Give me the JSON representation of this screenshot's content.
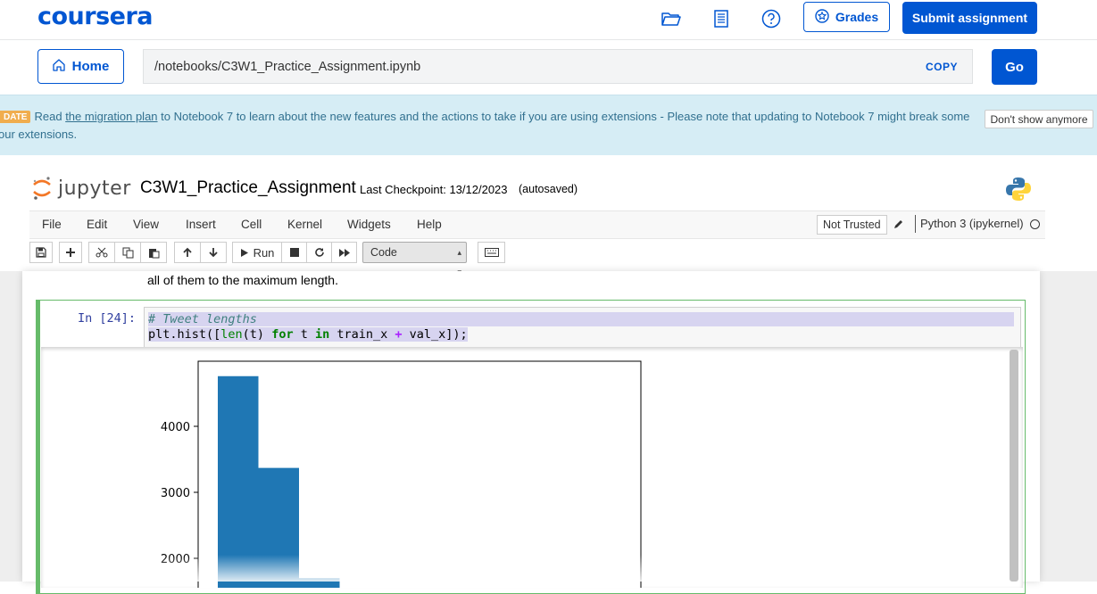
{
  "coursera": {
    "logo": "coursera",
    "icons": [
      "folder-icon",
      "notes-icon",
      "help-icon"
    ],
    "grades_label": "Grades",
    "submit_label": "Submit assignment",
    "home_label": "Home",
    "path": "/notebooks/C3W1_Practice_Assignment.ipynb",
    "copy_label": "COPY",
    "go_label": "Go",
    "brand_color": "#0056d2"
  },
  "banner": {
    "badge": "DATE",
    "text_before": "Read ",
    "link_text": "the migration plan",
    "text_after": " to Notebook 7 to learn about the new features and the actions to take if you are using extensions - Please note that updating to Notebook 7 might break some our extensions.",
    "dismiss_label": "Don't show anymore"
  },
  "jupyter": {
    "logo_text": "jupyter",
    "notebook_title": "C3W1_Practice_Assignment",
    "checkpoint": "Last Checkpoint: 13/12/2023",
    "autosave": "(autosaved)",
    "menu": [
      "File",
      "Edit",
      "View",
      "Insert",
      "Cell",
      "Kernel",
      "Widgets",
      "Help"
    ],
    "trust_label": "Not Trusted",
    "kernel_name": "Python 3 (ipykernel)",
    "run_label": "Run",
    "cell_type": "Code"
  },
  "notebook": {
    "prev_text": "all of them to the maximum length.",
    "in_prompt": "In [24]:",
    "code_comment": "# Tweet lengths",
    "code_line2": {
      "a": "plt.hist([",
      "b": "len",
      "c": "(t) ",
      "d": "for",
      "e": " t ",
      "f": "in",
      "g": " train_x ",
      "h": "+",
      "i": " val_x]);"
    }
  },
  "chart_data": {
    "type": "bar",
    "title": "",
    "xlabel": "",
    "ylabel": "",
    "yticks": [
      "2000",
      "3000",
      "4000"
    ],
    "ylim": [
      1700,
      5000
    ],
    "bins": [
      {
        "index": 0,
        "value": 4760
      },
      {
        "index": 1,
        "value": 3370
      },
      {
        "index": 2,
        "value": 1700
      }
    ],
    "bar_color": "#1f77b4"
  }
}
